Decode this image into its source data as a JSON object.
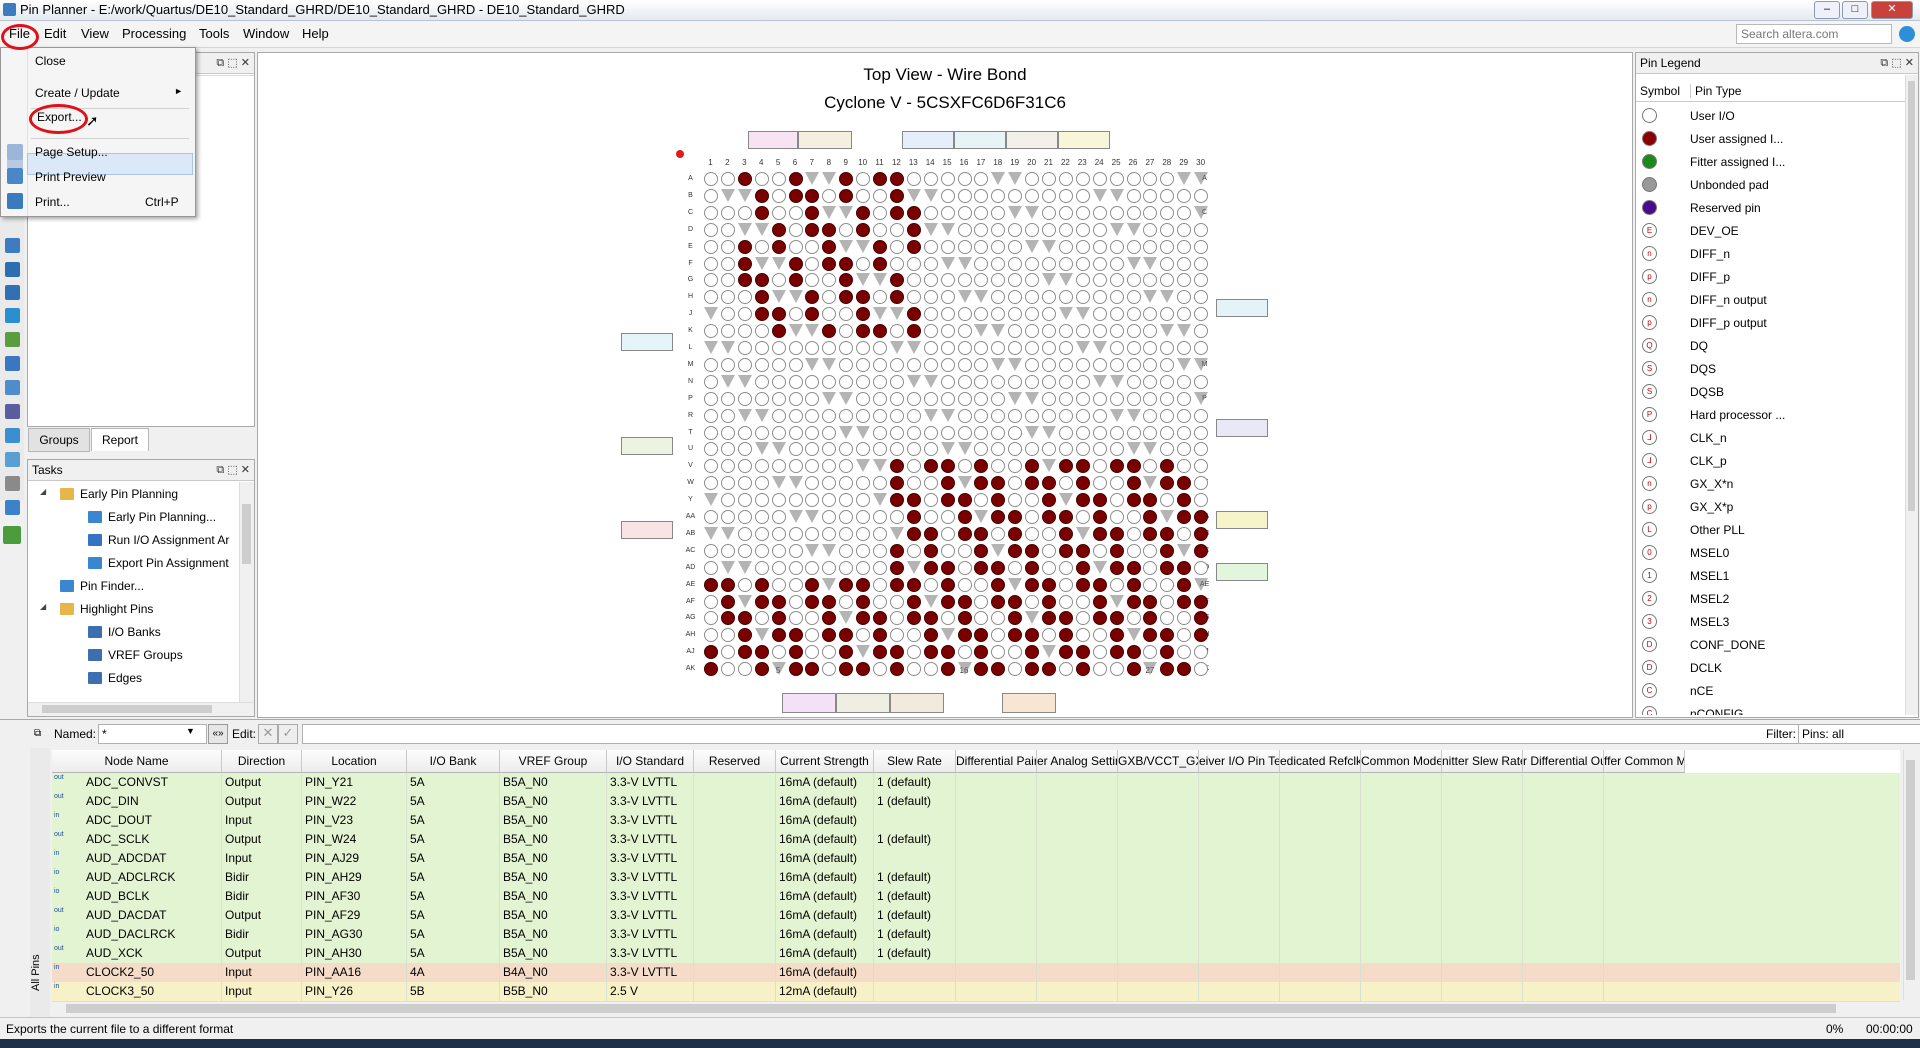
{
  "window": {
    "title": "Pin Planner - E:/work/Quartus/DE10_Standard_GHRD/DE10_Standard_GHRD - DE10_Standard_GHRD"
  },
  "menubar": {
    "items": [
      "File",
      "Edit",
      "View",
      "Processing",
      "Tools",
      "Window",
      "Help"
    ],
    "search_placeholder": "Search altera.com"
  },
  "file_menu": {
    "items": [
      {
        "label": "Close",
        "shortcut": ""
      },
      {
        "label": "Create / Update",
        "shortcut": "►"
      },
      {
        "label": "Export...",
        "shortcut": ""
      },
      {
        "label": "Page Setup...",
        "shortcut": ""
      },
      {
        "label": "Print Preview",
        "shortcut": ""
      },
      {
        "label": "Print...",
        "shortcut": "Ctrl+P"
      }
    ]
  },
  "left_panel": {
    "tabs": [
      "Groups",
      "Report"
    ]
  },
  "tasks": {
    "title": "Tasks",
    "items": [
      {
        "label": "Early Pin Planning",
        "level": 0,
        "icon": "folder-icon"
      },
      {
        "label": "Early Pin Planning...",
        "level": 1,
        "icon": "window-icon"
      },
      {
        "label": "Run I/O Assignment Ar",
        "level": 1,
        "icon": "play-icon"
      },
      {
        "label": "Export Pin Assignment",
        "level": 1,
        "icon": "window-icon"
      },
      {
        "label": "Pin Finder...",
        "level": 0,
        "icon": "window-icon"
      },
      {
        "label": "Highlight Pins",
        "level": 0,
        "icon": "folder-icon"
      },
      {
        "label": "I/O Banks",
        "level": 1,
        "icon": "table-icon"
      },
      {
        "label": "VREF Groups",
        "level": 1,
        "icon": "table-icon"
      },
      {
        "label": "Edges",
        "level": 1,
        "icon": "table-icon"
      }
    ]
  },
  "chip_view": {
    "title": "Top View - Wire Bond",
    "subtitle": "Cyclone V - 5CSXFC6D6F31C6",
    "col_labels": [
      "1",
      "2",
      "3",
      "4",
      "5",
      "6",
      "7",
      "8",
      "9",
      "10",
      "11",
      "12",
      "13",
      "14",
      "15",
      "16",
      "17",
      "18",
      "19",
      "20",
      "21",
      "22",
      "23",
      "24",
      "25",
      "26",
      "27",
      "28",
      "29",
      "30"
    ],
    "row_labels": [
      "A",
      "B",
      "C",
      "D",
      "E",
      "F",
      "G",
      "H",
      "J",
      "K",
      "L",
      "M",
      "N",
      "P",
      "R",
      "T",
      "U",
      "V",
      "W",
      "Y",
      "AA",
      "AB",
      "AC",
      "AD",
      "AE",
      "AF",
      "AG",
      "AH",
      "AJ",
      "AK"
    ]
  },
  "legend": {
    "title": "Pin Legend",
    "headers": [
      "Symbol",
      "Pin Type"
    ],
    "items": [
      {
        "label": "User I/O",
        "fill": "#ffffff",
        "mark": ""
      },
      {
        "label": "User assigned I...",
        "fill": "#8b0000",
        "mark": ""
      },
      {
        "label": "Fitter assigned I...",
        "fill": "#1a8a1a",
        "mark": ""
      },
      {
        "label": "Unbonded pad",
        "fill": "#999999",
        "mark": ""
      },
      {
        "label": "Reserved pin",
        "fill": "#4b0a8c",
        "mark": ""
      },
      {
        "label": "DEV_OE",
        "fill": "#ffffff",
        "mark": "E"
      },
      {
        "label": "DIFF_n",
        "fill": "#ffffff",
        "mark": "n"
      },
      {
        "label": "DIFF_p",
        "fill": "#ffffff",
        "mark": "p"
      },
      {
        "label": "DIFF_n output",
        "fill": "#ffffff",
        "mark": "n"
      },
      {
        "label": "DIFF_p output",
        "fill": "#ffffff",
        "mark": "p"
      },
      {
        "label": "DQ",
        "fill": "#ffffff",
        "mark": "Q"
      },
      {
        "label": "DQS",
        "fill": "#ffffff",
        "mark": "S"
      },
      {
        "label": "DQSB",
        "fill": "#ffffff",
        "mark": "S"
      },
      {
        "label": "Hard processor ...",
        "fill": "#ffffff",
        "mark": "P"
      },
      {
        "label": "CLK_n",
        "fill": "#ffffff",
        "mark": "⅃"
      },
      {
        "label": "CLK_p",
        "fill": "#ffffff",
        "mark": "⅃"
      },
      {
        "label": "GX_X*n",
        "fill": "#ffffff",
        "mark": "n"
      },
      {
        "label": "GX_X*p",
        "fill": "#ffffff",
        "mark": "p"
      },
      {
        "label": "Other PLL",
        "fill": "#ffffff",
        "mark": "L"
      },
      {
        "label": "MSEL0",
        "fill": "#ffffff",
        "mark": "0"
      },
      {
        "label": "MSEL1",
        "fill": "#ffffff",
        "mark": "1"
      },
      {
        "label": "MSEL2",
        "fill": "#ffffff",
        "mark": "2"
      },
      {
        "label": "MSEL3",
        "fill": "#ffffff",
        "mark": "3"
      },
      {
        "label": "CONF_DONE",
        "fill": "#ffffff",
        "mark": "D"
      },
      {
        "label": "DCLK",
        "fill": "#ffffff",
        "mark": "D"
      },
      {
        "label": "nCE",
        "fill": "#ffffff",
        "mark": "C"
      },
      {
        "label": "nCONFIG",
        "fill": "#ffffff",
        "mark": "C"
      }
    ]
  },
  "node_filter": {
    "named_label": "Named:",
    "named_value": "*",
    "edit_label": "Edit:",
    "filter_label": "Filter:",
    "filter_value": "Pins: all",
    "side_tab": "All Pins"
  },
  "table": {
    "headers": [
      "Node Name",
      "Direction",
      "Location",
      "I/O Bank",
      "VREF Group",
      "I/O Standard",
      "Reserved",
      "Current Strength",
      "Slew Rate",
      "Differential Pair",
      "er Analog Setting:",
      "GXB/VCCT_GXB V",
      "eiver I/O Pin Term",
      "edicated Refclk Pi",
      "Common Mode D",
      "nitter Slew Rate C",
      "r Differential Outp",
      "ffer Common Mo"
    ],
    "rows": [
      {
        "kind": "out",
        "name": "ADC_CONVST",
        "dir": "Output",
        "loc": "PIN_Y21",
        "bank": "5A",
        "vref": "B5A_N0",
        "std": "3.3-V LVTTL",
        "cur": "16mA (default)",
        "slew": "1 (default)",
        "bg": "#e3f4d2"
      },
      {
        "kind": "out",
        "name": "ADC_DIN",
        "dir": "Output",
        "loc": "PIN_W22",
        "bank": "5A",
        "vref": "B5A_N0",
        "std": "3.3-V LVTTL",
        "cur": "16mA (default)",
        "slew": "1 (default)",
        "bg": "#e3f4d2"
      },
      {
        "kind": "in",
        "name": "ADC_DOUT",
        "dir": "Input",
        "loc": "PIN_V23",
        "bank": "5A",
        "vref": "B5A_N0",
        "std": "3.3-V LVTTL",
        "cur": "16mA (default)",
        "slew": "",
        "bg": "#e3f4d2"
      },
      {
        "kind": "out",
        "name": "ADC_SCLK",
        "dir": "Output",
        "loc": "PIN_W24",
        "bank": "5A",
        "vref": "B5A_N0",
        "std": "3.3-V LVTTL",
        "cur": "16mA (default)",
        "slew": "1 (default)",
        "bg": "#e3f4d2"
      },
      {
        "kind": "in",
        "name": "AUD_ADCDAT",
        "dir": "Input",
        "loc": "PIN_AJ29",
        "bank": "5A",
        "vref": "B5A_N0",
        "std": "3.3-V LVTTL",
        "cur": "16mA (default)",
        "slew": "",
        "bg": "#e3f4d2"
      },
      {
        "kind": "io",
        "name": "AUD_ADCLRCK",
        "dir": "Bidir",
        "loc": "PIN_AH29",
        "bank": "5A",
        "vref": "B5A_N0",
        "std": "3.3-V LVTTL",
        "cur": "16mA (default)",
        "slew": "1 (default)",
        "bg": "#e3f4d2"
      },
      {
        "kind": "io",
        "name": "AUD_BCLK",
        "dir": "Bidir",
        "loc": "PIN_AF30",
        "bank": "5A",
        "vref": "B5A_N0",
        "std": "3.3-V LVTTL",
        "cur": "16mA (default)",
        "slew": "1 (default)",
        "bg": "#e3f4d2"
      },
      {
        "kind": "out",
        "name": "AUD_DACDAT",
        "dir": "Output",
        "loc": "PIN_AF29",
        "bank": "5A",
        "vref": "B5A_N0",
        "std": "3.3-V LVTTL",
        "cur": "16mA (default)",
        "slew": "1 (default)",
        "bg": "#e3f4d2"
      },
      {
        "kind": "io",
        "name": "AUD_DACLRCK",
        "dir": "Bidir",
        "loc": "PIN_AG30",
        "bank": "5A",
        "vref": "B5A_N0",
        "std": "3.3-V LVTTL",
        "cur": "16mA (default)",
        "slew": "1 (default)",
        "bg": "#e3f4d2"
      },
      {
        "kind": "out",
        "name": "AUD_XCK",
        "dir": "Output",
        "loc": "PIN_AH30",
        "bank": "5A",
        "vref": "B5A_N0",
        "std": "3.3-V LVTTL",
        "cur": "16mA (default)",
        "slew": "1 (default)",
        "bg": "#e3f4d2"
      },
      {
        "kind": "in",
        "name": "CLOCK2_50",
        "dir": "Input",
        "loc": "PIN_AA16",
        "bank": "4A",
        "vref": "B4A_N0",
        "std": "3.3-V LVTTL",
        "cur": "16mA (default)",
        "slew": "",
        "bg": "#f5dcc8"
      },
      {
        "kind": "in",
        "name": "CLOCK3_50",
        "dir": "Input",
        "loc": "PIN_Y26",
        "bank": "5B",
        "vref": "B5B_N0",
        "std": "2.5 V",
        "cur": "12mA (default)",
        "slew": "",
        "bg": "#f7f1c7"
      }
    ]
  },
  "status": {
    "message": "Exports the current file to a different format",
    "progress": "0%",
    "time": "00:00:00"
  }
}
